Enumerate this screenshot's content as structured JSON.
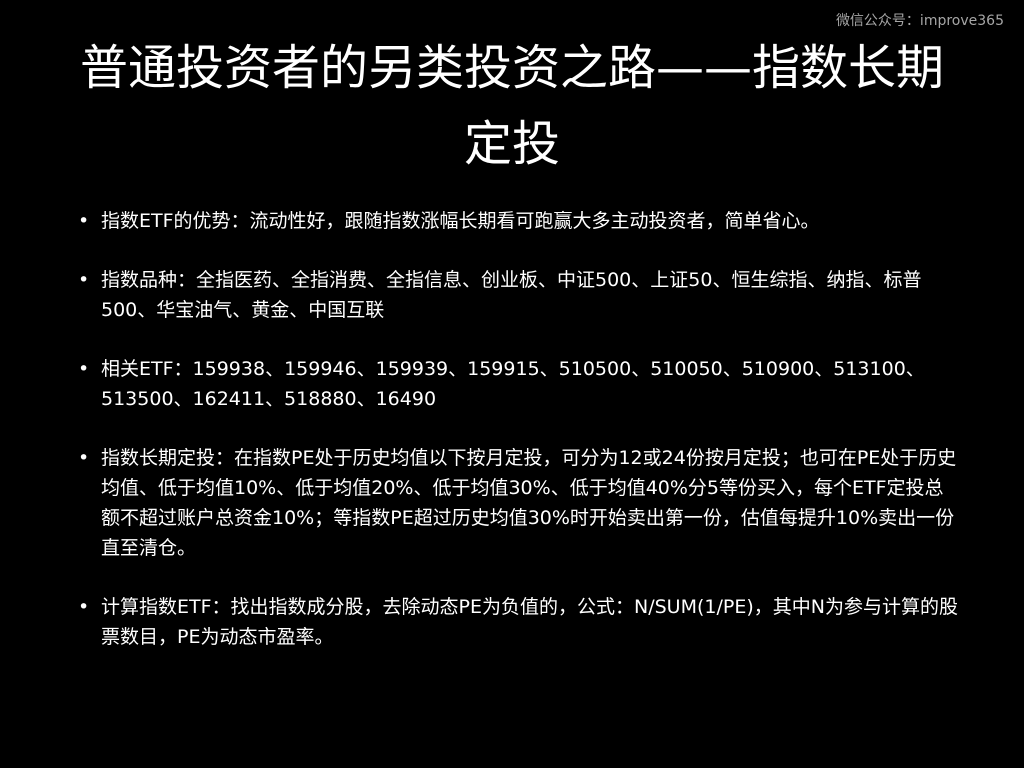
{
  "watermark": "微信公众号：improve365",
  "title": "普通投资者的另类投资之路——指数长期定投",
  "bullet_marker": "•",
  "bullets": [
    "指数ETF的优势：流动性好，跟随指数涨幅长期看可跑赢大多主动投资者，简单省心。",
    "指数品种：全指医药、全指消费、全指信息、创业板、中证500、上证50、恒生综指、纳指、标普500、华宝油气、黄金、中国互联",
    "相关ETF：159938、159946、159939、159915、510500、510050、510900、513100、513500、162411、518880、16490",
    "指数长期定投：在指数PE处于历史均值以下按月定投，可分为12或24份按月定投；也可在PE处于历史均值、低于均值10%、低于均值20%、低于均值30%、低于均值40%分5等份买入，每个ETF定投总额不超过账户总资金10%；等指数PE超过历史均值30%时开始卖出第一份，估值每提升10%卖出一份直至清仓。",
    "计算指数ETF：找出指数成分股，去除动态PE为负值的，公式：N/SUM(1/PE)，其中N为参与计算的股票数目，PE为动态市盈率。"
  ]
}
